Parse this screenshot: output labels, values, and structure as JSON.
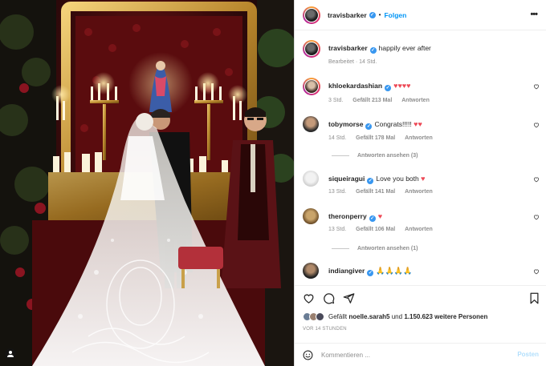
{
  "post": {
    "author": "travisbarker",
    "follow_label": "Folgen",
    "separator": "•",
    "more_icon": "more-horizontal-icon",
    "caption": "happily ever after",
    "caption_meta": "Bearbeitet · 14 Std."
  },
  "comments": [
    {
      "user": "khloekardashian",
      "verified": true,
      "text": "",
      "hearts": "♥♥♥♥",
      "time": "3 Std.",
      "likes": "Gefällt 213 Mal",
      "reply": "Antworten"
    },
    {
      "user": "tobymorse",
      "verified": true,
      "text": "Congrats!!!!!",
      "hearts": "♥♥",
      "time": "14 Std.",
      "likes": "Gefällt 178 Mal",
      "reply": "Antworten",
      "view_replies": "Antworten ansehen (3)"
    },
    {
      "user": "siqueiragui",
      "verified": true,
      "text": "Love you both",
      "hearts": "♥",
      "time": "13 Std.",
      "likes": "Gefällt 141 Mal",
      "reply": "Antworten"
    },
    {
      "user": "theronperry",
      "verified": true,
      "text": "",
      "hearts": "♥",
      "time": "13 Std.",
      "likes": "Gefällt 106 Mal",
      "reply": "Antworten",
      "view_replies": "Antworten ansehen (1)"
    },
    {
      "user": "indiangiver",
      "verified": true,
      "text": "",
      "emoji": "🙏🙏🙏🙏"
    }
  ],
  "actions": {
    "like_icon": "heart-icon",
    "comment_icon": "comment-icon",
    "share_icon": "send-icon",
    "save_icon": "bookmark-icon",
    "liked_by_prefix": "Gefällt",
    "liked_by_user": "noelle.sarah5",
    "liked_by_joiner": "und",
    "liked_by_count": "1.150.623 weitere Personen",
    "timestamp": "VOR 14 STUNDEN"
  },
  "composer": {
    "placeholder": "Kommentieren ...",
    "post_label": "Posten",
    "emoji_icon": "smiley-icon"
  },
  "colors": {
    "accent": "#0095f6",
    "heart": "#ed4956",
    "verified": "#3897f0",
    "muted": "#8e8e8e"
  }
}
